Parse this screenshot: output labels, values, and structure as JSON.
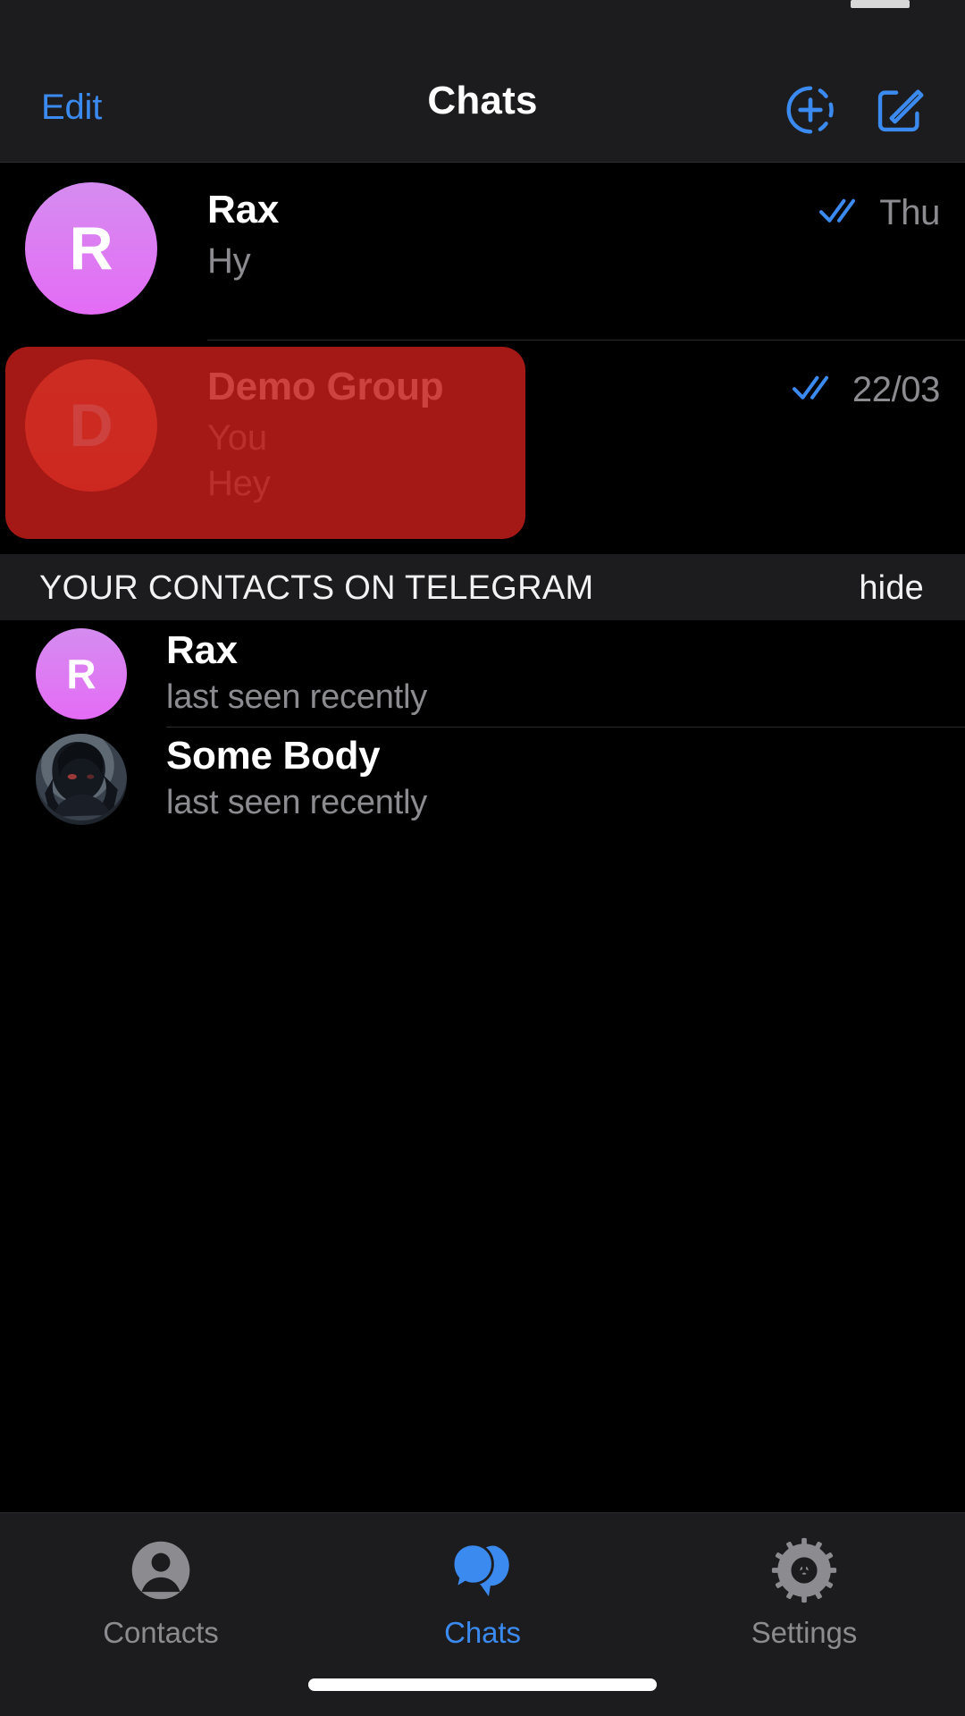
{
  "colors": {
    "accent_blue": "#3b8aef",
    "background": "#000000",
    "bar_background": "#1c1c1e",
    "secondary_text": "#8c8c90",
    "highlight_red": "#c41e19",
    "avatar_purple": "#e46cf5",
    "avatar_orange": "#ff6046"
  },
  "nav": {
    "left_button": "Edit",
    "title": "Chats",
    "add_story_icon": "circle-plus-dashed-icon",
    "compose_icon": "compose-pencil-icon"
  },
  "chats": [
    {
      "name": "Rax",
      "preview": "Hy",
      "preview2": "",
      "time": "Thu",
      "avatar_letter": "R",
      "avatar_style": "purple",
      "read_status": "read-double-check-icon",
      "highlighted": false
    },
    {
      "name": "Demo Group",
      "preview": "You",
      "preview2": "Hey",
      "time": "22/03",
      "avatar_letter": "D",
      "avatar_style": "orange",
      "read_status": "read-double-check-icon",
      "highlighted": true
    }
  ],
  "contacts_section": {
    "title": "YOUR CONTACTS ON TELEGRAM",
    "action": "hide",
    "contacts": [
      {
        "name": "Rax",
        "status": "last seen recently",
        "avatar_letter": "R",
        "avatar_style": "purple"
      },
      {
        "name": "Some Body",
        "status": "last seen recently",
        "avatar_letter": "",
        "avatar_style": "photo"
      }
    ]
  },
  "tabs": [
    {
      "label": "Contacts",
      "icon": "person-icon",
      "active": false
    },
    {
      "label": "Chats",
      "icon": "chat-bubbles-icon",
      "active": true
    },
    {
      "label": "Settings",
      "icon": "gear-icon",
      "active": false
    }
  ]
}
